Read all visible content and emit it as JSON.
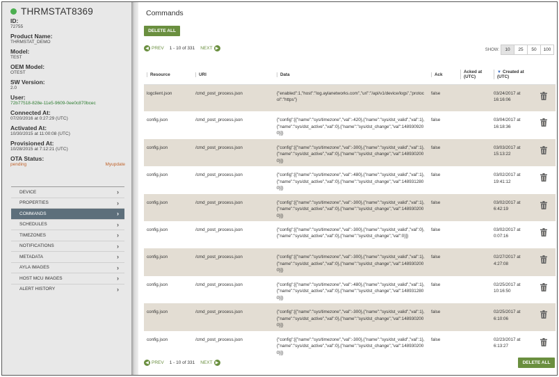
{
  "device": {
    "name": "THRMSTAT8369",
    "status_color": "#4caf50",
    "fields": [
      {
        "label": "ID:",
        "value": "72755"
      },
      {
        "label": "Product Name:",
        "value": "THRMSTAT_DEMO"
      },
      {
        "label": "Model:",
        "value": "TEST"
      },
      {
        "label": "OEM Model:",
        "value": "OTEST"
      },
      {
        "label": "SW Version:",
        "value": "2.0"
      },
      {
        "label": "User:",
        "value": "72b77518-828e-11e5-9609-0ee0c870bcec"
      },
      {
        "label": "Connected At:",
        "value": "07/20/2016 at 0:27:29 (UTC)"
      },
      {
        "label": "Activated At:",
        "value": "10/30/2015 at 11:00:08 (UTC)"
      },
      {
        "label": "Provisioned At:",
        "value": "10/28/2015 at 7:12:21 (UTC)"
      }
    ],
    "ota": {
      "label": "OTA Status:",
      "status": "pending",
      "action": "Myupdate"
    }
  },
  "nav": [
    {
      "label": "DEVICE",
      "active": false
    },
    {
      "label": "PROPERTIES",
      "active": false
    },
    {
      "label": "COMMANDS",
      "active": true
    },
    {
      "label": "SCHEDULES",
      "active": false
    },
    {
      "label": "TIMEZONES",
      "active": false
    },
    {
      "label": "NOTIFICATIONS",
      "active": false
    },
    {
      "label": "METADATA",
      "active": false
    },
    {
      "label": "AYLA IMAGES",
      "active": false
    },
    {
      "label": "HOST MCU IMAGES",
      "active": false
    },
    {
      "label": "ALERT HISTORY",
      "active": false
    }
  ],
  "main": {
    "title": "Commands",
    "delete_all": "DELETE ALL",
    "pager": {
      "prev": "PREV",
      "next": "NEXT",
      "count": "1 - 10 of 331"
    },
    "show": {
      "label": "SHOW:",
      "options": [
        "10",
        "25",
        "50",
        "100"
      ],
      "selected": "10"
    },
    "columns": {
      "resource": "Resource",
      "uri": "URI",
      "data": "Data",
      "ack": "Ack",
      "acked_at": "Acked at (UTC)",
      "created_at": "Created at (UTC)"
    },
    "rows": [
      {
        "resource": "logclient.json",
        "uri": "/cmd_post_process.json",
        "data": "{\"enabled\":1,\"host\":\"log.aylanetworks.com\",\"uri\":\"/api/v1/device/logs\",\"protocol\":\"https\"}",
        "ack": "false",
        "acked_at": "",
        "created_at": "03/24/2017 at 16:16:06"
      },
      {
        "resource": "config.json",
        "uri": "/cmd_post_process.json",
        "data": "{\"config\":[{\"name\":\"sys/timezone\",\"val\":-420},{\"name\":\"sys/dst_valid\",\"val\":1},{\"name\":\"sys/dst_active\",\"val\":0},{\"name\":\"sys/dst_change\",\"val\":1489309200}]}",
        "ack": "false",
        "acked_at": "",
        "created_at": "03/04/2017 at 16:18:36"
      },
      {
        "resource": "config.json",
        "uri": "/cmd_post_process.json",
        "data": "{\"config\":[{\"name\":\"sys/timezone\",\"val\":-300},{\"name\":\"sys/dst_valid\",\"val\":1},{\"name\":\"sys/dst_active\",\"val\":0},{\"name\":\"sys/dst_change\",\"val\":1489302000}]}",
        "ack": "false",
        "acked_at": "",
        "created_at": "03/03/2017 at 15:13:22"
      },
      {
        "resource": "config.json",
        "uri": "/cmd_post_process.json",
        "data": "{\"config\":[{\"name\":\"sys/timezone\",\"val\":-480},{\"name\":\"sys/dst_valid\",\"val\":1},{\"name\":\"sys/dst_active\",\"val\":0},{\"name\":\"sys/dst_change\",\"val\":1489312800}]}",
        "ack": "false",
        "acked_at": "",
        "created_at": "03/02/2017 at 19:41:12"
      },
      {
        "resource": "config.json",
        "uri": "/cmd_post_process.json",
        "data": "{\"config\":[{\"name\":\"sys/timezone\",\"val\":-300},{\"name\":\"sys/dst_valid\",\"val\":1},{\"name\":\"sys/dst_active\",\"val\":0},{\"name\":\"sys/dst_change\",\"val\":1489302000}]}",
        "ack": "false",
        "acked_at": "",
        "created_at": "03/02/2017 at 6:42:19"
      },
      {
        "resource": "config.json",
        "uri": "/cmd_post_process.json",
        "data": "{\"config\":[{\"name\":\"sys/timezone\",\"val\":-300},{\"name\":\"sys/dst_valid\",\"val\":0},{\"name\":\"sys/dst_active\",\"val\":0},{\"name\":\"sys/dst_change\",\"val\":0}]}",
        "ack": "false",
        "acked_at": "",
        "created_at": "03/02/2017 at 0:07:16"
      },
      {
        "resource": "config.json",
        "uri": "/cmd_post_process.json",
        "data": "{\"config\":[{\"name\":\"sys/timezone\",\"val\":-300},{\"name\":\"sys/dst_valid\",\"val\":1},{\"name\":\"sys/dst_active\",\"val\":0},{\"name\":\"sys/dst_change\",\"val\":1489302000}]}",
        "ack": "false",
        "acked_at": "",
        "created_at": "02/27/2017 at 4:27:08"
      },
      {
        "resource": "config.json",
        "uri": "/cmd_post_process.json",
        "data": "{\"config\":[{\"name\":\"sys/timezone\",\"val\":-480},{\"name\":\"sys/dst_valid\",\"val\":1},{\"name\":\"sys/dst_active\",\"val\":0},{\"name\":\"sys/dst_change\",\"val\":1489312800}]}",
        "ack": "false",
        "acked_at": "",
        "created_at": "02/25/2017 at 10:16:50"
      },
      {
        "resource": "config.json",
        "uri": "/cmd_post_process.json",
        "data": "{\"config\":[{\"name\":\"sys/timezone\",\"val\":-300},{\"name\":\"sys/dst_valid\",\"val\":1},{\"name\":\"sys/dst_active\",\"val\":0},{\"name\":\"sys/dst_change\",\"val\":1489302000}]}",
        "ack": "false",
        "acked_at": "",
        "created_at": "02/25/2017 at 6:10:06"
      },
      {
        "resource": "config.json",
        "uri": "/cmd_post_process.json",
        "data": "{\"config\":[{\"name\":\"sys/timezone\",\"val\":-300},{\"name\":\"sys/dst_valid\",\"val\":1},{\"name\":\"sys/dst_active\",\"val\":0},{\"name\":\"sys/dst_change\",\"val\":1489302000}]}",
        "ack": "false",
        "acked_at": "",
        "created_at": "02/23/2017 at 6:13:27"
      }
    ],
    "row_icon": "trash-icon"
  }
}
